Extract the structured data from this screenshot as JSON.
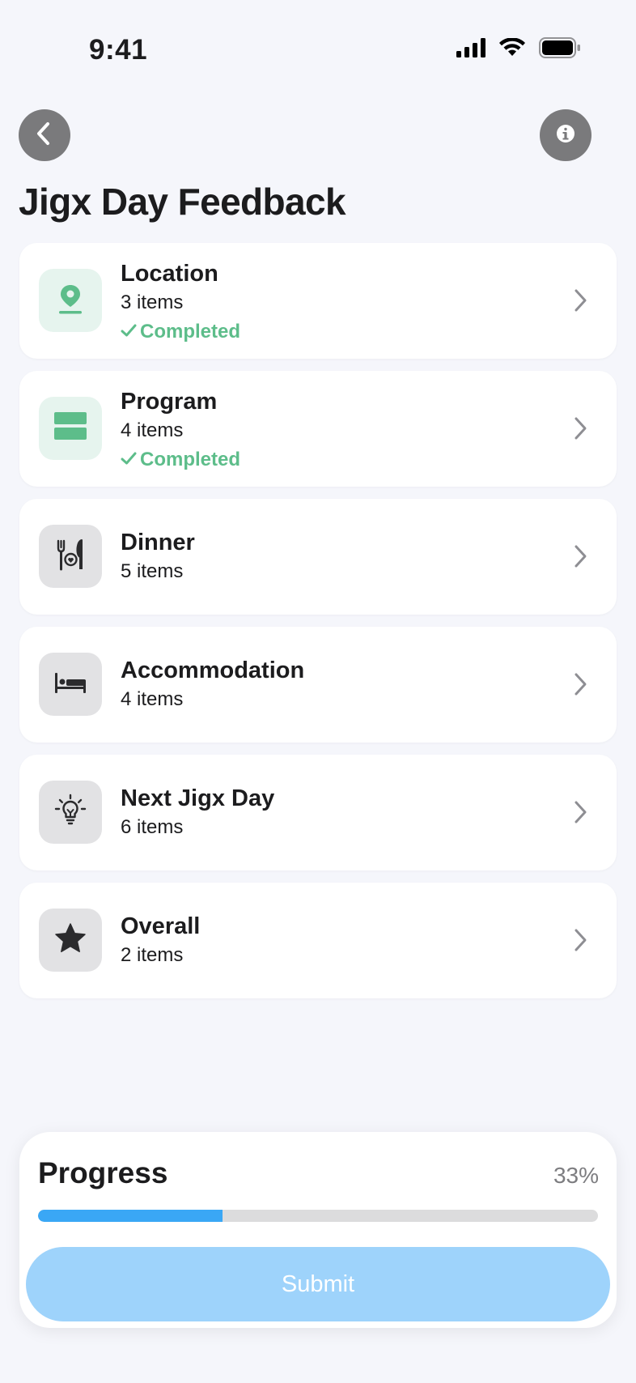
{
  "status_bar": {
    "time": "9:41"
  },
  "header": {
    "title": "Jigx Day Feedback",
    "back_icon": "chevron-left-icon",
    "info_icon": "info-icon"
  },
  "colors": {
    "accent": "#3aa7f5",
    "completed": "#5dbd8a",
    "submit_disabled": "#9ed3fb"
  },
  "sections": [
    {
      "title": "Location",
      "count": "3 items",
      "status": "Completed",
      "icon": "location-pin-icon",
      "completed": true
    },
    {
      "title": "Program",
      "count": "4 items",
      "status": "Completed",
      "icon": "program-stack-icon",
      "completed": true
    },
    {
      "title": "Dinner",
      "count": "5 items",
      "icon": "fork-knife-icon",
      "completed": false
    },
    {
      "title": "Accommodation",
      "count": "4 items",
      "icon": "bed-icon",
      "completed": false
    },
    {
      "title": "Next Jigx Day",
      "count": "6 items",
      "icon": "lightbulb-icon",
      "completed": false
    },
    {
      "title": "Overall",
      "count": "2 items",
      "icon": "star-icon",
      "completed": false
    }
  ],
  "progress": {
    "label": "Progress",
    "percent_label": "33%",
    "value": 0.33
  },
  "submit": {
    "label": "Submit"
  }
}
